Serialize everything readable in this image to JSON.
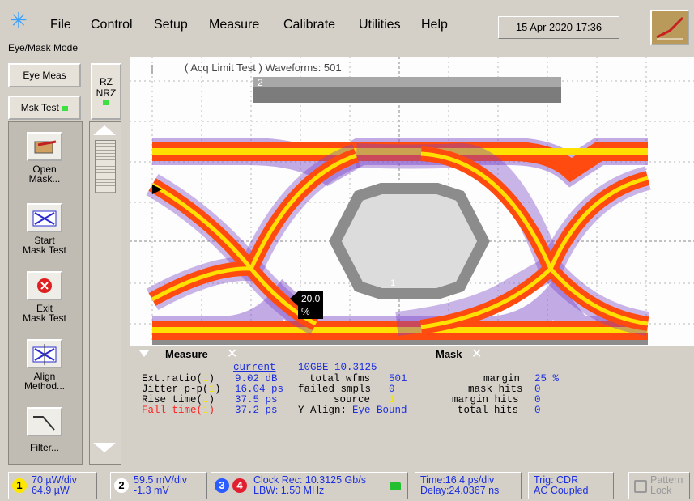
{
  "menu": {
    "items": [
      "File",
      "Control",
      "Setup",
      "Measure",
      "Calibrate",
      "Utilities",
      "Help"
    ],
    "datetime": "15 Apr 2020   17:36",
    "mode": "Eye/Mask Mode"
  },
  "side": {
    "eye_meas": "Eye Meas",
    "rz": "RZ",
    "nrz": "NRZ",
    "msk_test": "Msk Test",
    "tools": [
      {
        "label1": "Open",
        "label2": "Mask..."
      },
      {
        "label1": "Start",
        "label2": "Mask Test"
      },
      {
        "label1": "Exit",
        "label2": "Mask Test"
      },
      {
        "label1": "Align",
        "label2": "Method..."
      },
      {
        "label1": "Filter...",
        "label2": ""
      }
    ]
  },
  "plot": {
    "acq_title": "( Acq Limit Test )  Waveforms: 501",
    "region_label": "2",
    "region_label_2": "1",
    "marker": "20.0 %"
  },
  "measure": {
    "tab": "Measure",
    "mask_tab": "Mask",
    "current_header": "current",
    "rows": [
      {
        "name": "Ext.ratio(",
        "ch": "1",
        "value": "9.02 dB"
      },
      {
        "name": "Jitter p-p(",
        "ch": "1",
        "value": "16.04 ps"
      },
      {
        "name": "Rise time(",
        "ch": "1",
        "value": "37.5 ps"
      },
      {
        "name": "Fall time(",
        "ch": "1",
        "value": "37.2 ps"
      }
    ],
    "mask_std": "10GBE 10.3125",
    "mask_rows": [
      {
        "name": "total wfms",
        "value": "501"
      },
      {
        "name": "failed smpls",
        "value": "0"
      },
      {
        "name": "source",
        "value": "1"
      }
    ],
    "y_align_label": "Y Align:",
    "y_align_value": "Eye Bound",
    "margin_rows": [
      {
        "name": "margin",
        "value": "25 %"
      },
      {
        "name": "mask hits",
        "value": "0"
      },
      {
        "name": "margin hits",
        "value": "0"
      },
      {
        "name": "total hits",
        "value": "0"
      }
    ]
  },
  "status": {
    "ch1_line1": "70 µW/div",
    "ch1_line2": "64.9 µW",
    "ch2_line1": "59.5 mV/div",
    "ch2_line2": "-1.3 mV",
    "clock_line1": "Clock Rec: 10.3125 Gb/s",
    "clock_line2": "LBW: 1.50 MHz",
    "time_line1": "Time:16.4 ps/div",
    "time_line2": "Delay:24.0367 ns",
    "trig_line1": "Trig: CDR",
    "trig_line2": "AC Coupled",
    "pattern_line1": "Pattern",
    "pattern_line2": "Lock",
    "ch_nums": [
      "1",
      "2",
      "3",
      "4"
    ]
  },
  "colors": {
    "trace_outer": "#7a45c8",
    "trace_mid": "#ff4a10",
    "trace_core": "#fff200",
    "mask_gray": "#8c8c8c",
    "text_blue": "#1c2ee0"
  }
}
